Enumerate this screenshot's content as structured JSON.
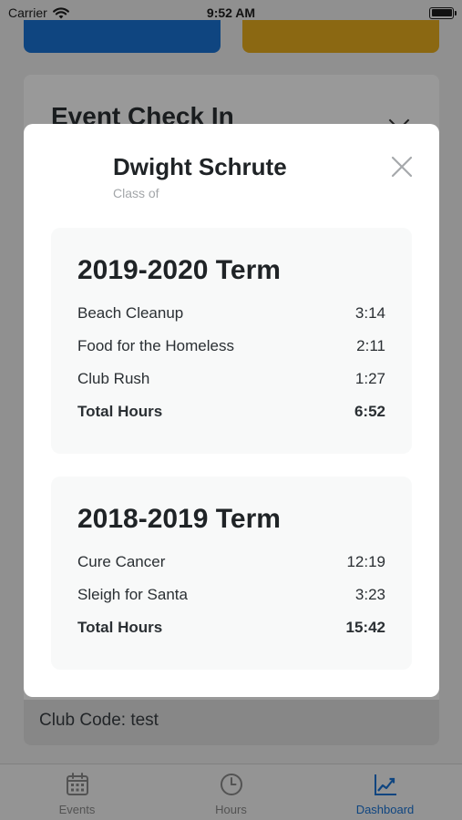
{
  "status_bar": {
    "carrier": "Carrier",
    "time": "9:52 AM"
  },
  "background": {
    "card_title": "Event Check In",
    "club_code": "Club Code: test"
  },
  "tabs": [
    {
      "label": "Events",
      "icon": "calendar-icon",
      "active": false
    },
    {
      "label": "Hours",
      "icon": "clock-icon",
      "active": false
    },
    {
      "label": "Dashboard",
      "icon": "chart-icon",
      "active": true
    }
  ],
  "modal": {
    "name": "Dwight Schrute",
    "subtitle": "Class of",
    "terms": [
      {
        "title": "2019-2020 Term",
        "rows": [
          {
            "label": "Beach Cleanup",
            "value": "3:14"
          },
          {
            "label": "Food for the Homeless",
            "value": "2:11"
          },
          {
            "label": "Club Rush",
            "value": "1:27"
          }
        ],
        "total_label": "Total Hours",
        "total_value": "6:52"
      },
      {
        "title": "2018-2019 Term",
        "rows": [
          {
            "label": "Cure Cancer",
            "value": "12:19"
          },
          {
            "label": "Sleigh for Santa",
            "value": "3:23"
          }
        ],
        "total_label": "Total Hours",
        "total_value": "15:42"
      }
    ]
  },
  "colors": {
    "accent_blue": "#1a74d6",
    "accent_gold": "#e8ad1f",
    "tab_inactive": "#8a8a8a"
  }
}
